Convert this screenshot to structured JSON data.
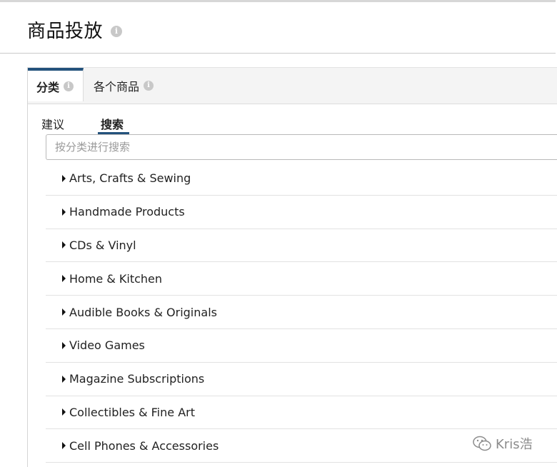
{
  "page": {
    "title": "商品投放"
  },
  "tabs": [
    {
      "label": "分类",
      "active": true
    },
    {
      "label": "各个商品",
      "active": false
    }
  ],
  "subtabs": [
    {
      "label": "建议",
      "active": false
    },
    {
      "label": "搜索",
      "active": true
    }
  ],
  "search": {
    "placeholder": "按分类进行搜索",
    "value": ""
  },
  "categories": [
    "Arts, Crafts & Sewing",
    "Handmade Products",
    "CDs & Vinyl",
    "Home & Kitchen",
    "Audible Books & Originals",
    "Video Games",
    "Magazine Subscriptions",
    "Collectibles & Fine Art",
    "Cell Phones & Accessories"
  ],
  "watermark": {
    "text": "Kris浩"
  },
  "colors": {
    "accent": "#23527c",
    "tab_bg": "#f4f4f4",
    "border": "#d7d7d7"
  }
}
